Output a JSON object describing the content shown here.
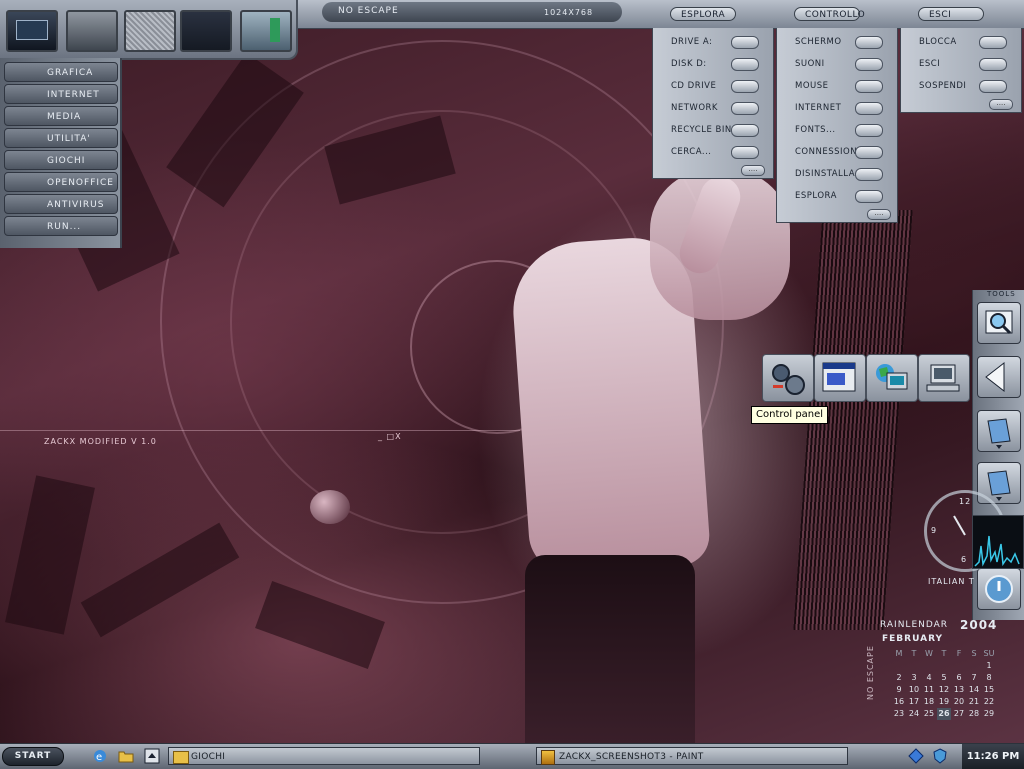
{
  "top_bar": {
    "title": "NO ESCAPE",
    "resolution": "1024X768",
    "menus": [
      {
        "label": "ESPLORA"
      },
      {
        "label": "CONTROLLO"
      },
      {
        "label": "ESCI"
      }
    ]
  },
  "launcher": {
    "items": [
      "GRAFICA",
      "INTERNET",
      "MEDIA",
      "UTILITA'",
      "GIOCHI",
      "OPENOFFICE",
      "ANTIVIRUS",
      "RUN..."
    ]
  },
  "esplora_menu": [
    "DRIVE A:",
    "DISK D:",
    "CD DRIVE",
    "NETWORK",
    "RECYCLE BIN",
    "CERCA..."
  ],
  "controllo_menu": [
    "SCHERMO",
    "SUONI",
    "MOUSE",
    "INTERNET",
    "FONTS...",
    "CONNESSIONI",
    "DISINSTALLA",
    "ESPLORA"
  ],
  "esci_menu": [
    "BLOCCA",
    "ESCI",
    "SOSPENDI"
  ],
  "more_dots": "....",
  "desktop_text": {
    "version": "ZACKX MODIFIED V 1.0",
    "minmax": "_ □X",
    "italian_time": "ITALIAN T",
    "tools_label": "TOOLS",
    "no_escape_vertical": "NO ESCAPE"
  },
  "tooltip": "Control panel",
  "clock_face": {
    "n12": "12",
    "n9": "9",
    "n6": "6"
  },
  "calendar": {
    "brand": "RAINLENDAR",
    "year": "2004",
    "month": "FEBRUARY",
    "weekdays": [
      "M",
      "T",
      "W",
      "T",
      "F",
      "S",
      "SU"
    ],
    "days": [
      "1",
      "2",
      "3",
      "4",
      "5",
      "6",
      "7",
      "8",
      "9",
      "10",
      "11",
      "12",
      "13",
      "14",
      "15",
      "16",
      "17",
      "18",
      "19",
      "20",
      "21",
      "22",
      "23",
      "24",
      "25",
      "26",
      "27",
      "28",
      "29"
    ],
    "today": "26"
  },
  "taskbar": {
    "start_label": "START",
    "items": [
      {
        "label": "GIOCHI"
      },
      {
        "label": "ZACKX_SCREENSHOT3 - PAINT"
      }
    ],
    "clock": "11:26 PM"
  },
  "colors": {
    "accent": "#8a939f",
    "tooltip_bg": "#ffffe1"
  }
}
